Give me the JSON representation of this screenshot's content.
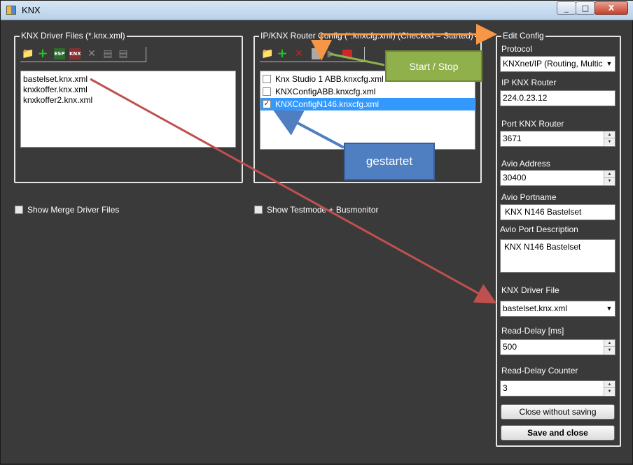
{
  "window": {
    "title": "KNX",
    "minimize": "_",
    "maximize": "□",
    "close": "X"
  },
  "driver_files": {
    "title": "KNX Driver Files (*.knx.xml)",
    "items": [
      "bastelset.knx.xml",
      "knxkoffer.knx.xml",
      "knxkoffer2.knx.xml"
    ],
    "toolbar": {
      "esp_label": "ESP",
      "knx_label": "KNX"
    }
  },
  "router_config": {
    "title": "IP/KNX Router Config (*.knxcfg.xml) (Checked = Started)",
    "items": [
      {
        "label": "Knx Studio 1 ABB.knxcfg.xml",
        "checked": false,
        "selected": false
      },
      {
        "label": "KNXConfigABB.knxcfg.xml",
        "checked": false,
        "selected": false
      },
      {
        "label": "KNXConfigN146.knxcfg.xml",
        "checked": true,
        "selected": true
      }
    ]
  },
  "options": {
    "merge_label": "Show Merge Driver Files",
    "testmode_label": "Show Testmode + Busmonitor"
  },
  "edit_config": {
    "title": "Edit Config",
    "protocol_label": "Protocol",
    "protocol_value": "KNXnet/IP (Routing, Multic",
    "ip_label": "IP KNX Router",
    "ip_value": "224.0.23.12",
    "port_label": "Port KNX Router",
    "port_value": "3671",
    "avio_address_label": "Avio Address",
    "avio_address_value": "30400",
    "avio_portname_label": "Avio Portname",
    "avio_portname_value": "KNX N146 Bastelset",
    "avio_desc_label": "Avio Port Description",
    "avio_desc_value": "KNX N146 Bastelset",
    "driver_file_label": "KNX Driver File",
    "driver_file_value": "bastelset.knx.xml",
    "read_delay_label": "Read-Delay [ms]",
    "read_delay_value": "500",
    "read_counter_label": "Read-Delay Counter",
    "read_counter_value": "3",
    "close_button": "Close without saving",
    "save_button": "Save and close"
  },
  "annotations": {
    "start_stop": "Start / Stop",
    "started": "gestartet",
    "colors": {
      "green": "#8fb04a",
      "blue": "#4f7fc0",
      "red_arrow": "#c0504d",
      "orange_arrow": "#f79646"
    }
  }
}
